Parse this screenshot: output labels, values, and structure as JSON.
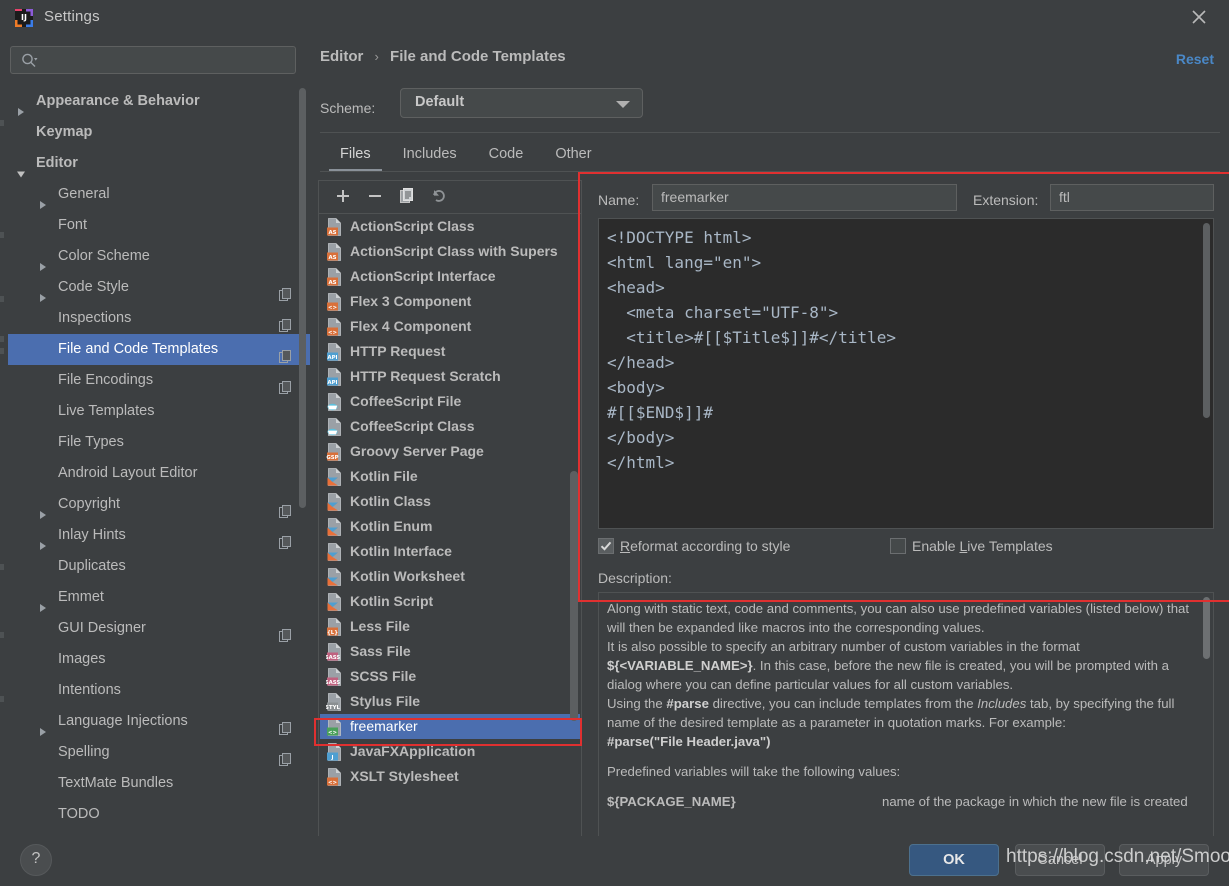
{
  "window": {
    "title": "Settings",
    "logo_icon": "intellij-idea-logo",
    "close_icon": "close-icon"
  },
  "sidebar": {
    "search": {
      "placeholder": "",
      "value": "",
      "icon": "search-icon"
    },
    "items": [
      {
        "label": "Appearance & Behavior",
        "indent": 0,
        "arrow": "right",
        "bold": true,
        "copy": false,
        "selected": false
      },
      {
        "label": "Keymap",
        "indent": 0,
        "arrow": "none",
        "bold": true,
        "copy": false,
        "selected": false
      },
      {
        "label": "Editor",
        "indent": 0,
        "arrow": "down",
        "bold": true,
        "copy": false,
        "selected": false
      },
      {
        "label": "General",
        "indent": 1,
        "arrow": "right",
        "bold": false,
        "copy": false,
        "selected": false
      },
      {
        "label": "Font",
        "indent": 1,
        "arrow": "none",
        "bold": false,
        "copy": false,
        "selected": false
      },
      {
        "label": "Color Scheme",
        "indent": 1,
        "arrow": "right",
        "bold": false,
        "copy": false,
        "selected": false
      },
      {
        "label": "Code Style",
        "indent": 1,
        "arrow": "right",
        "bold": false,
        "copy": true,
        "selected": false
      },
      {
        "label": "Inspections",
        "indent": 1,
        "arrow": "none",
        "bold": false,
        "copy": true,
        "selected": false
      },
      {
        "label": "File and Code Templates",
        "indent": 1,
        "arrow": "none",
        "bold": false,
        "copy": true,
        "selected": true
      },
      {
        "label": "File Encodings",
        "indent": 1,
        "arrow": "none",
        "bold": false,
        "copy": true,
        "selected": false
      },
      {
        "label": "Live Templates",
        "indent": 1,
        "arrow": "none",
        "bold": false,
        "copy": false,
        "selected": false
      },
      {
        "label": "File Types",
        "indent": 1,
        "arrow": "none",
        "bold": false,
        "copy": false,
        "selected": false
      },
      {
        "label": "Android Layout Editor",
        "indent": 1,
        "arrow": "none",
        "bold": false,
        "copy": false,
        "selected": false
      },
      {
        "label": "Copyright",
        "indent": 1,
        "arrow": "right",
        "bold": false,
        "copy": true,
        "selected": false
      },
      {
        "label": "Inlay Hints",
        "indent": 1,
        "arrow": "right",
        "bold": false,
        "copy": true,
        "selected": false
      },
      {
        "label": "Duplicates",
        "indent": 1,
        "arrow": "none",
        "bold": false,
        "copy": false,
        "selected": false
      },
      {
        "label": "Emmet",
        "indent": 1,
        "arrow": "right",
        "bold": false,
        "copy": false,
        "selected": false
      },
      {
        "label": "GUI Designer",
        "indent": 1,
        "arrow": "none",
        "bold": false,
        "copy": true,
        "selected": false
      },
      {
        "label": "Images",
        "indent": 1,
        "arrow": "none",
        "bold": false,
        "copy": false,
        "selected": false
      },
      {
        "label": "Intentions",
        "indent": 1,
        "arrow": "none",
        "bold": false,
        "copy": false,
        "selected": false
      },
      {
        "label": "Language Injections",
        "indent": 1,
        "arrow": "right",
        "bold": false,
        "copy": true,
        "selected": false
      },
      {
        "label": "Spelling",
        "indent": 1,
        "arrow": "none",
        "bold": false,
        "copy": true,
        "selected": false
      },
      {
        "label": "TextMate Bundles",
        "indent": 1,
        "arrow": "none",
        "bold": false,
        "copy": false,
        "selected": false
      },
      {
        "label": "TODO",
        "indent": 1,
        "arrow": "none",
        "bold": false,
        "copy": false,
        "selected": false
      }
    ]
  },
  "header": {
    "breadcrumb_root": "Editor",
    "breadcrumb_sep": "›",
    "breadcrumb_leaf": "File and Code Templates",
    "reset_label": "Reset",
    "scheme_label": "Scheme:",
    "scheme_value": "Default"
  },
  "tabs": [
    {
      "label": "Files",
      "active": true
    },
    {
      "label": "Includes",
      "active": false
    },
    {
      "label": "Code",
      "active": false
    },
    {
      "label": "Other",
      "active": false
    }
  ],
  "list_toolbar": [
    {
      "name": "add-template-button",
      "icon": "plus-icon"
    },
    {
      "name": "remove-template-button",
      "icon": "minus-icon"
    },
    {
      "name": "copy-template-button",
      "icon": "copy-icon"
    },
    {
      "name": "reset-template-button",
      "icon": "undo-icon"
    }
  ],
  "templates": [
    {
      "label": "ActionScript Class",
      "icon": "as-file-icon",
      "kind": "as",
      "selected": false
    },
    {
      "label": "ActionScript Class with Supers",
      "icon": "as-file-icon",
      "kind": "as",
      "selected": false
    },
    {
      "label": "ActionScript Interface",
      "icon": "as-file-icon",
      "kind": "as",
      "selected": false
    },
    {
      "label": "Flex 3 Component",
      "icon": "flex-file-icon",
      "kind": "code",
      "selected": false
    },
    {
      "label": "Flex 4 Component",
      "icon": "flex-file-icon",
      "kind": "code",
      "selected": false
    },
    {
      "label": "HTTP Request",
      "icon": "api-file-icon",
      "kind": "api",
      "selected": false
    },
    {
      "label": "HTTP Request Scratch",
      "icon": "api-file-icon",
      "kind": "api",
      "selected": false
    },
    {
      "label": "CoffeeScript File",
      "icon": "coffeescript-file-icon",
      "kind": "coffee",
      "selected": false
    },
    {
      "label": "CoffeeScript Class",
      "icon": "coffeescript-file-icon",
      "kind": "coffee",
      "selected": false
    },
    {
      "label": "Groovy Server Page",
      "icon": "gsp-file-icon",
      "kind": "gsp",
      "selected": false
    },
    {
      "label": "Kotlin File",
      "icon": "kotlin-file-icon",
      "kind": "kotlin",
      "selected": false
    },
    {
      "label": "Kotlin Class",
      "icon": "kotlin-file-icon",
      "kind": "kotlin",
      "selected": false
    },
    {
      "label": "Kotlin Enum",
      "icon": "kotlin-file-icon",
      "kind": "kotlin",
      "selected": false
    },
    {
      "label": "Kotlin Interface",
      "icon": "kotlin-file-icon",
      "kind": "kotlin",
      "selected": false
    },
    {
      "label": "Kotlin Worksheet",
      "icon": "kotlin-file-icon",
      "kind": "kotlin",
      "selected": false
    },
    {
      "label": "Kotlin Script",
      "icon": "kotlin-file-icon",
      "kind": "kotlin",
      "selected": false
    },
    {
      "label": "Less File",
      "icon": "less-file-icon",
      "kind": "less",
      "selected": false
    },
    {
      "label": "Sass File",
      "icon": "sass-file-icon",
      "kind": "sass",
      "selected": false
    },
    {
      "label": "SCSS File",
      "icon": "scss-file-icon",
      "kind": "sass",
      "selected": false
    },
    {
      "label": "Stylus File",
      "icon": "stylus-file-icon",
      "kind": "styl",
      "selected": false
    },
    {
      "label": "freemarker",
      "icon": "freemarker-file-icon",
      "kind": "ftl",
      "selected": true
    },
    {
      "label": "JavaFXApplication",
      "icon": "java-file-icon",
      "kind": "java",
      "selected": false
    },
    {
      "label": "XSLT Stylesheet",
      "icon": "xslt-file-icon",
      "kind": "code",
      "selected": false
    }
  ],
  "detail": {
    "name_label": "Name:",
    "name_value": "freemarker",
    "extension_label": "Extension:",
    "extension_value": "ftl",
    "code": "<!DOCTYPE html>\n<html lang=\"en\">\n<head>\n  <meta charset=\"UTF-8\">\n  <title>#[[$Title$]]#</title>\n</head>\n<body>\n#[[$END$]]#\n</body>\n</html>",
    "reformat_label_pre": "R",
    "reformat_label_post": "eformat according to style",
    "reformat_checked": true,
    "livetpl_label_pre": "Enable ",
    "livetpl_label_mid": "L",
    "livetpl_label_post": "ive Templates",
    "livetpl_checked": false,
    "description_label": "Description:",
    "description": {
      "p1a": "Along with static text, code and comments, you can also use predefined variables (listed below) that will then be expanded like macros into the corresponding values.",
      "p1b": "It is also possible to specify an arbitrary number of custom variables in the format ",
      "p1b_code": "${<VARIABLE_NAME>}",
      "p1b_rest": ". In this case, before the new file is created, you will be prompted with a dialog where you can define particular values for all custom variables.",
      "p1c_pre": "Using the ",
      "p1c_code": "#parse",
      "p1c_mid": " directive, you can include templates from the ",
      "p1c_em": "Includes",
      "p1c_post": " tab, by specifying the full name of the desired template as a parameter in quotation marks. For example:",
      "p1c_example": "#parse(\"File Header.java\")",
      "p2": "Predefined variables will take the following values:",
      "var_name": "${PACKAGE_NAME}",
      "var_desc": "name of the package in which the new file is created"
    }
  },
  "footer": {
    "help_label": "?",
    "ok_label": "OK",
    "cancel_label": "Cancel",
    "apply_label": "Apply"
  },
  "watermark": "https://blog.csdn.net/Smootht",
  "colors": {
    "background": "#3c3f41",
    "selection": "#4b6eaf",
    "accent_link": "#4a88c7",
    "editor_background": "#2b2b2b",
    "editor_text": "#a9b7c6",
    "ok_button": "#365880",
    "annotation": "#e03030"
  }
}
